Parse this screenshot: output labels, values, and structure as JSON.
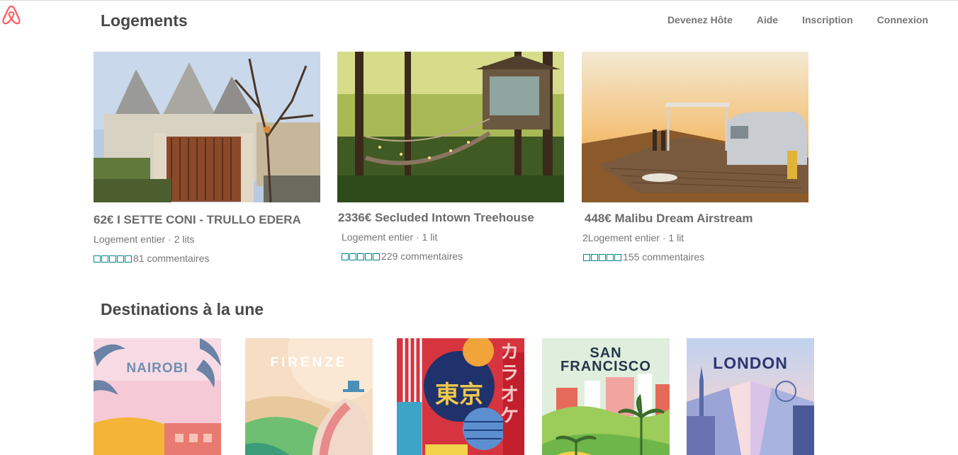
{
  "brand": {
    "logo_icon": "airbnb-belo-icon",
    "accent": "#ff5a5f"
  },
  "nav": {
    "host": "Devenez Hôte",
    "help": "Aide",
    "signup": "Inscription",
    "login": "Connexion"
  },
  "logements": {
    "title": "Logements",
    "items": [
      {
        "title": "62€ I SETTE CONI - TRULLO EDERA",
        "sub": "Logement entier · 2 lits",
        "reviews": "81 commentaires",
        "stars": 5
      },
      {
        "title": "2336€ Secluded Intown Treehouse",
        "sub": "Logement entier · 1 lit",
        "reviews": "229 commentaires",
        "stars": 5
      },
      {
        "title": "448€ Malibu Dream Airstream",
        "sub": "2Logement entier · 1 lit",
        "reviews": "155 commentaires",
        "stars": 5
      }
    ]
  },
  "destinations": {
    "title": "Destinations à la une",
    "items": [
      {
        "label": "NAIROBI"
      },
      {
        "label": "FIRENZE"
      },
      {
        "label": "東京",
        "side": "カラオケ"
      },
      {
        "label": "SAN",
        "label2": "FRANCISCO"
      },
      {
        "label": "LONDON"
      }
    ]
  },
  "colors": {
    "star": "#008489",
    "text": "#484848",
    "muted": "#767676"
  }
}
